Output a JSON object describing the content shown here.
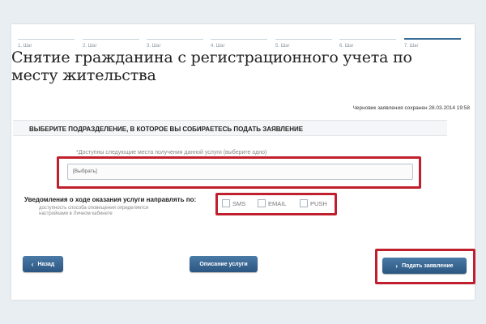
{
  "steps": [
    "1. Шаг",
    "2. Шаг",
    "3. Шаг",
    "4. Шаг",
    "5. Шаг",
    "6. Шаг",
    "7. Шаг"
  ],
  "active_step": 7,
  "title": "Снятие гражданина с регистрационного учета по месту жительства",
  "draft_note": "Черновик заявления сохранен 28.03.2014 19:58",
  "section_header": "ВЫБЕРИТЕ ПОДРАЗДЕЛЕНИЕ, В КОТОРОЕ ВЫ СОБИРАЕТЕСЬ ПОДАТЬ ЗАЯВЛЕНИЕ",
  "places_hint": "*Доступны следующие места получения данной услуги (выберите одно)",
  "select_value": "[Выбрать]",
  "notifications": {
    "label": "Уведомления о ходе оказания услуги направлять по:",
    "sub": "доступность способа оповещения определяется настройками в Личном кабинете",
    "options": [
      "SMS",
      "EMAIL",
      "PUSH"
    ]
  },
  "buttons": {
    "back": "Назад",
    "description": "Описание услуги",
    "submit": "Подать заявление"
  },
  "colors": {
    "accent": "#2b5681",
    "highlight": "#c0202e"
  }
}
